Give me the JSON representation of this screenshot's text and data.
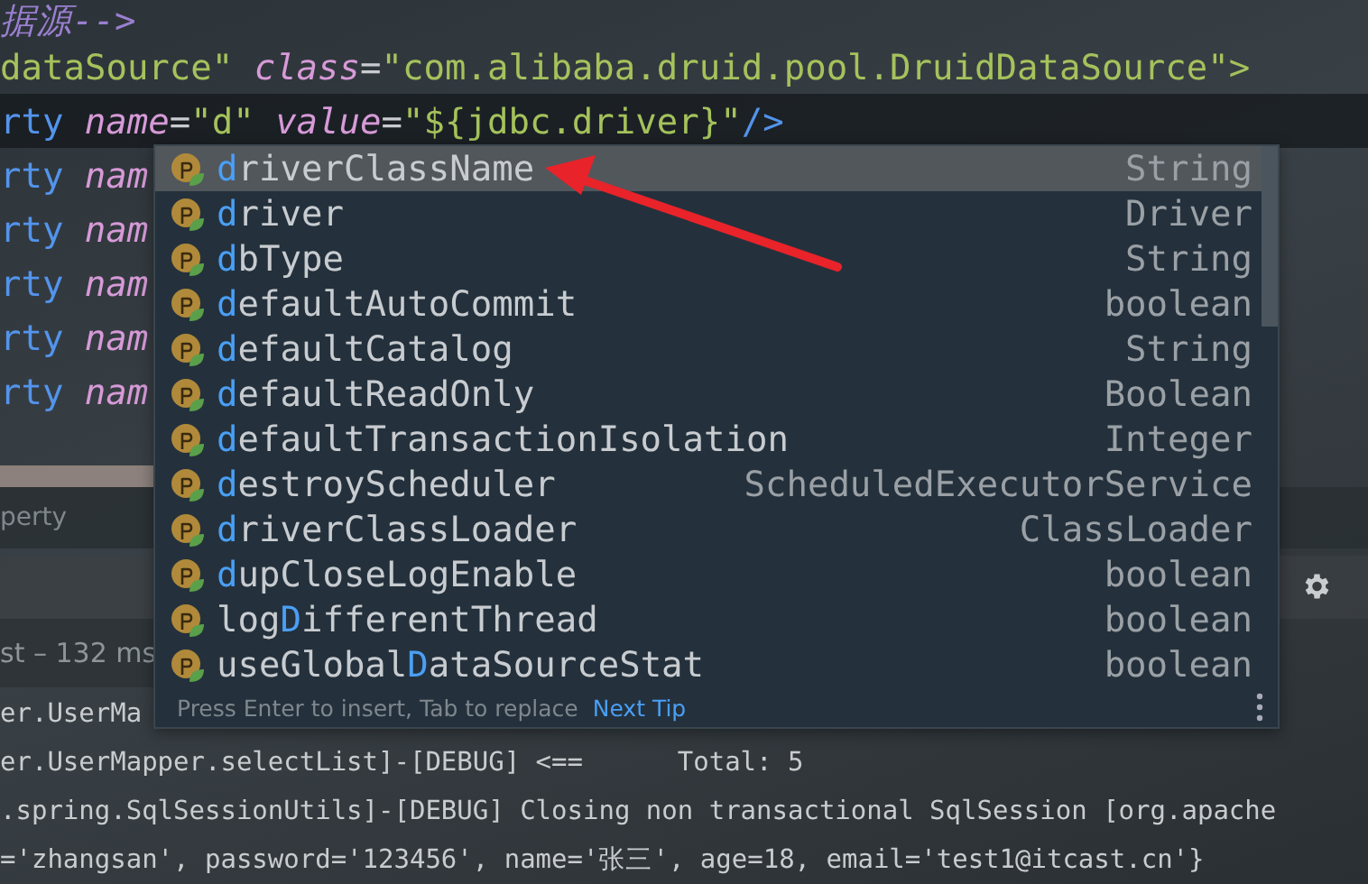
{
  "editor": {
    "lines": [
      {
        "current": false,
        "words": [
          [
            {
              "kind": "comment",
              "text": "据源-->"
            }
          ]
        ]
      },
      {
        "current": false,
        "words": [
          [
            {
              "kind": "string",
              "text": "dataSource\""
            }
          ],
          [
            {
              "kind": "attr",
              "text": "class"
            },
            {
              "kind": "plain",
              "text": "="
            },
            {
              "kind": "string",
              "text": "\"com.alibaba.druid.pool.DruidDataSource\""
            },
            {
              "kind": "string",
              "text": ">"
            }
          ]
        ]
      },
      {
        "current": true,
        "words": [
          [
            {
              "kind": "tag",
              "text": "rty"
            }
          ],
          [
            {
              "kind": "attr",
              "text": "name"
            },
            {
              "kind": "plain",
              "text": "="
            },
            {
              "kind": "string",
              "text": "\"d\""
            }
          ],
          [
            {
              "kind": "attr",
              "text": "value"
            },
            {
              "kind": "plain",
              "text": "="
            },
            {
              "kind": "string",
              "text": "\"${jdbc.driver}\""
            },
            {
              "kind": "tag",
              "text": "/>"
            }
          ]
        ]
      },
      {
        "current": false,
        "words": [
          [
            {
              "kind": "tag",
              "text": "rty"
            }
          ],
          [
            {
              "kind": "attr",
              "text": "nam"
            }
          ]
        ]
      },
      {
        "current": false,
        "words": [
          [
            {
              "kind": "tag",
              "text": "rty"
            }
          ],
          [
            {
              "kind": "attr",
              "text": "nam"
            }
          ]
        ]
      },
      {
        "current": false,
        "words": [
          [
            {
              "kind": "tag",
              "text": "rty"
            }
          ],
          [
            {
              "kind": "attr",
              "text": "nam"
            }
          ]
        ]
      },
      {
        "current": false,
        "words": [
          [
            {
              "kind": "tag",
              "text": "rty"
            }
          ],
          [
            {
              "kind": "attr",
              "text": "nam"
            }
          ]
        ]
      },
      {
        "current": false,
        "words": [
          [
            {
              "kind": "tag",
              "text": "rty"
            }
          ],
          [
            {
              "kind": "attr",
              "text": "nam"
            }
          ]
        ]
      }
    ]
  },
  "breadcrumb": "perty",
  "run_panel": {
    "status": "st – 132 ms"
  },
  "console": {
    "lines": [
      "er.UserMa",
      "er.UserMapper.selectList]-[DEBUG] <==      Total: 5",
      ".spring.SqlSessionUtils]-[DEBUG] Closing non transactional SqlSession [org.apache",
      "='zhangsan', password='123456', name='张三', age=18, email='test1@itcast.cn'}"
    ]
  },
  "completion": {
    "items": [
      {
        "selected": true,
        "parts": [
          {
            "text": "d",
            "match": true
          },
          {
            "text": "riverClassName",
            "match": false
          }
        ],
        "type": "String"
      },
      {
        "selected": false,
        "parts": [
          {
            "text": "d",
            "match": true
          },
          {
            "text": "river",
            "match": false
          }
        ],
        "type": "Driver"
      },
      {
        "selected": false,
        "parts": [
          {
            "text": "d",
            "match": true
          },
          {
            "text": "bType",
            "match": false
          }
        ],
        "type": "String"
      },
      {
        "selected": false,
        "parts": [
          {
            "text": "d",
            "match": true
          },
          {
            "text": "efaultAutoCommit",
            "match": false
          }
        ],
        "type": "boolean"
      },
      {
        "selected": false,
        "parts": [
          {
            "text": "d",
            "match": true
          },
          {
            "text": "efaultCatalog",
            "match": false
          }
        ],
        "type": "String"
      },
      {
        "selected": false,
        "parts": [
          {
            "text": "d",
            "match": true
          },
          {
            "text": "efaultReadOnly",
            "match": false
          }
        ],
        "type": "Boolean"
      },
      {
        "selected": false,
        "parts": [
          {
            "text": "d",
            "match": true
          },
          {
            "text": "efaultTransactionIsolation",
            "match": false
          }
        ],
        "type": "Integer"
      },
      {
        "selected": false,
        "parts": [
          {
            "text": "d",
            "match": true
          },
          {
            "text": "estroyScheduler",
            "match": false
          }
        ],
        "type": "ScheduledExecutorService"
      },
      {
        "selected": false,
        "parts": [
          {
            "text": "d",
            "match": true
          },
          {
            "text": "riverClassLoader",
            "match": false
          }
        ],
        "type": "ClassLoader"
      },
      {
        "selected": false,
        "parts": [
          {
            "text": "d",
            "match": true
          },
          {
            "text": "upCloseLogEnable",
            "match": false
          }
        ],
        "type": "boolean"
      },
      {
        "selected": false,
        "parts": [
          {
            "text": "log",
            "match": false
          },
          {
            "text": "D",
            "match": true
          },
          {
            "text": "ifferentThread",
            "match": false
          }
        ],
        "type": "boolean"
      },
      {
        "selected": false,
        "parts": [
          {
            "text": "useGlobal",
            "match": false
          },
          {
            "text": "D",
            "match": true
          },
          {
            "text": "ataSourceStat",
            "match": false
          }
        ],
        "type": "boolean"
      }
    ],
    "hint": "Press Enter to insert, Tab to replace",
    "next_tip": "Next Tip"
  }
}
